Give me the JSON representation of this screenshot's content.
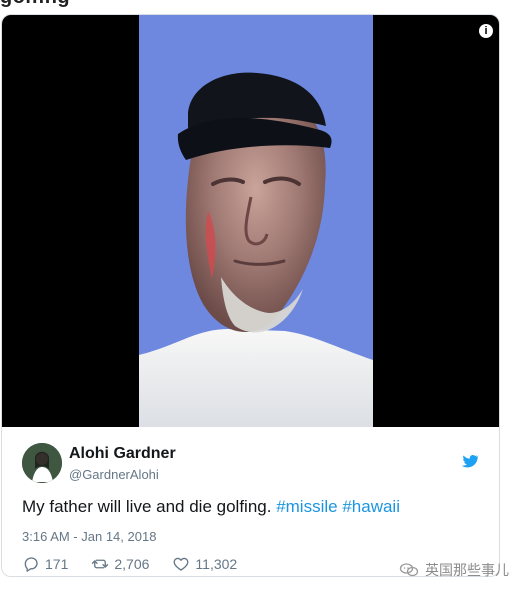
{
  "top_snippet": "golfing",
  "tweet": {
    "author_name": "Alohi Gardner",
    "author_handle": "@GardnerAlohi",
    "text_plain": "My father will live and die golfing. ",
    "hashtag_1": "#missile",
    "hashtag_2": "#hawaii",
    "timestamp": "3:16 AM - Jan 14, 2018",
    "replies": "171",
    "retweets": "2,706",
    "likes": "11,302"
  },
  "watermark": {
    "label": "英国那些事儿"
  },
  "icons": {
    "info": "info-icon",
    "twitter": "twitter-bird-icon",
    "reply": "reply-icon",
    "retweet": "retweet-icon",
    "like": "heart-icon",
    "watermark": "wechat-icon"
  },
  "colors": {
    "link": "#1b95e0",
    "twitter_blue": "#1da1f2",
    "secondary_text": "#657786",
    "sky_blue": "#6d87de"
  }
}
